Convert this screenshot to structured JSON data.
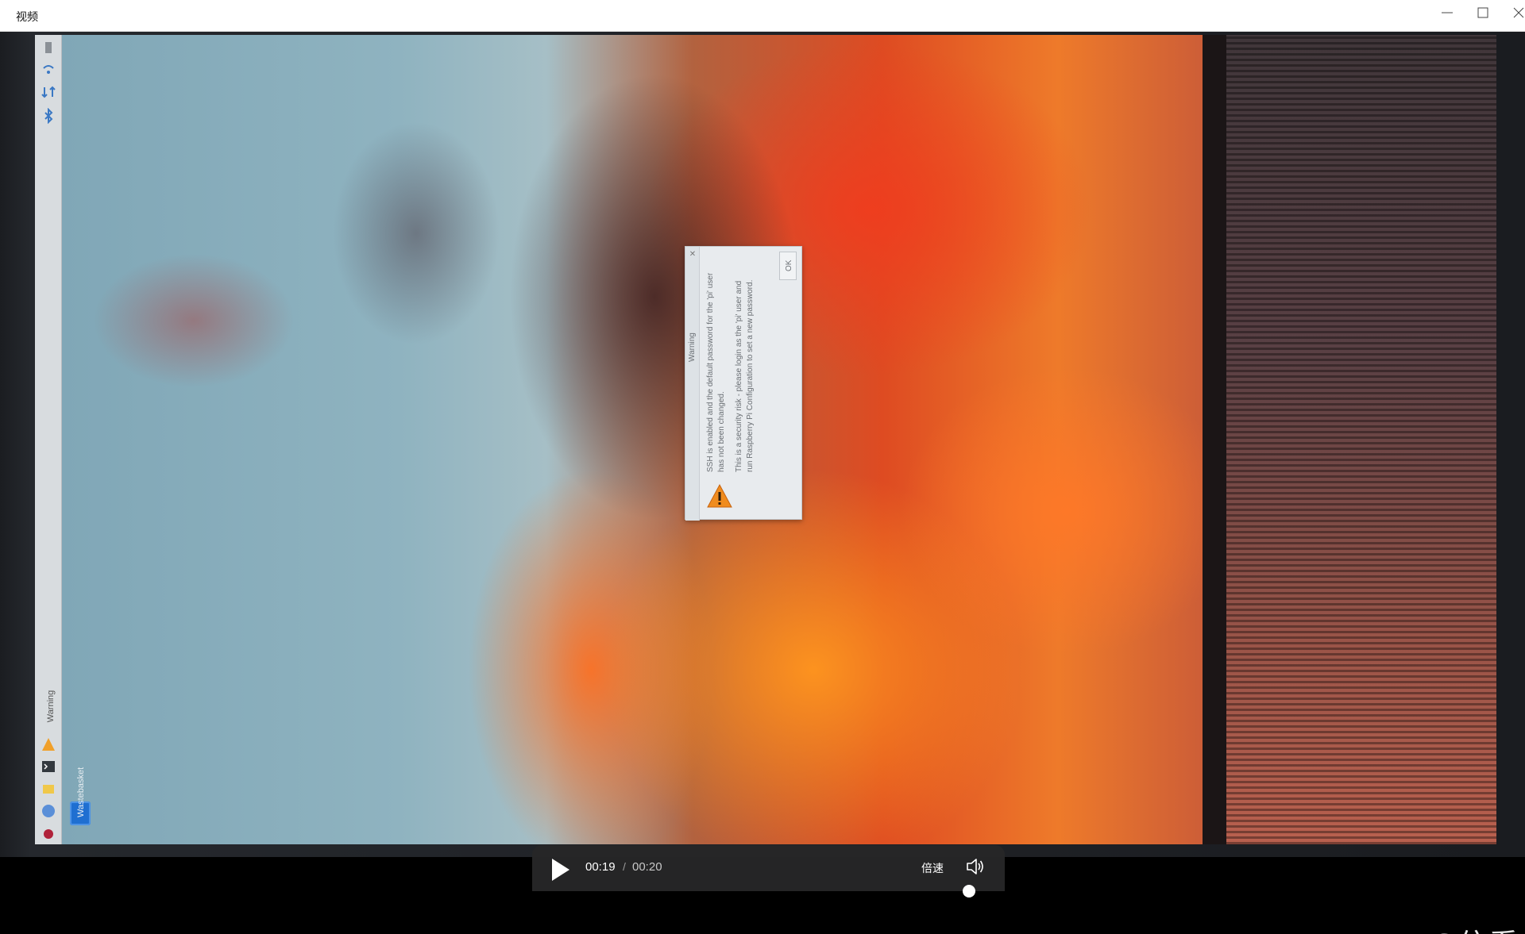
{
  "window": {
    "title": "视频",
    "controls": [
      "minimize-icon",
      "maximize-icon",
      "close-icon"
    ]
  },
  "desktop": {
    "taskbar_warning_label": "Warning",
    "wastebasket_label": "Wastebasket"
  },
  "dialog": {
    "title": "Warning",
    "line1": "SSH is enabled and the default password for the 'pi' user",
    "line2": "has not been changed.",
    "line3": "This is a security risk - please login as the 'pi' user and",
    "line4": "run Raspberry Pi Configuration to set a new password.",
    "ok_label": "OK"
  },
  "player": {
    "current_time": "00:19",
    "separator": "/",
    "duration": "00:20",
    "speed_label": "倍速",
    "volume_icon": "volume-icon",
    "play_icon": "play-icon"
  },
  "watermark": "CSDN @信看",
  "colors": {
    "titlebar_bg": "#ffffff",
    "controls_bg": "#262628",
    "warning_accent": "#f08c1e"
  }
}
